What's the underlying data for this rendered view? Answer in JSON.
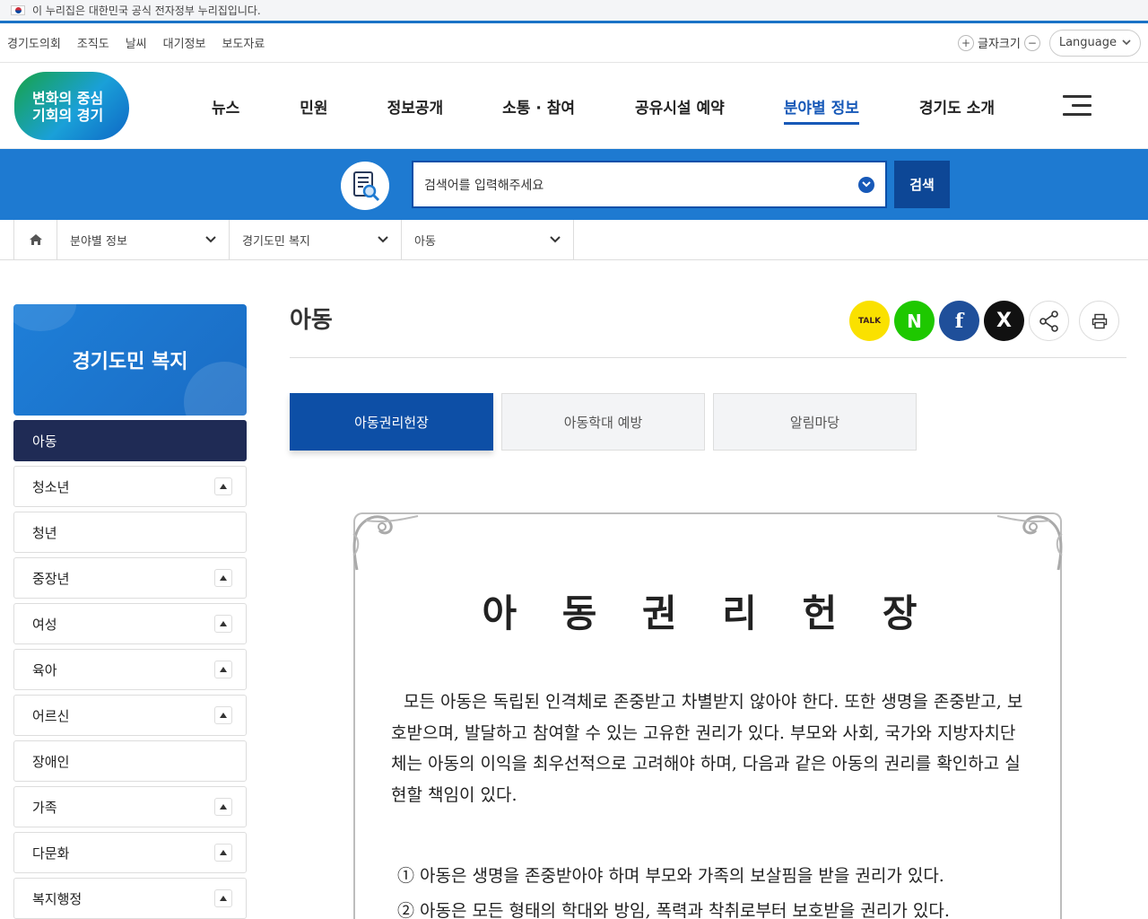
{
  "gov_banner": {
    "text": "이 누리집은 대한민국 공식 전자정부 누리집입니다."
  },
  "util": {
    "links": [
      "경기도의회",
      "조직도",
      "날씨",
      "대기정보",
      "보도자료"
    ],
    "fontsize_label": "글자크기",
    "language_label": "Language"
  },
  "logo": {
    "line1": "변화의 중심",
    "line2": "기회의 경기"
  },
  "nav": [
    "뉴스",
    "민원",
    "정보공개",
    "소통 · 참여",
    "공유시설 예약",
    "분야별 정보",
    "경기도 소개"
  ],
  "nav_active_index": 5,
  "search": {
    "placeholder": "검색어를 입력해주세요",
    "button": "검색"
  },
  "breadcrumb": {
    "level1": "분야별 정보",
    "level2": "경기도민 복지",
    "level3": "아동"
  },
  "sidebar": {
    "title": "경기도민 복지",
    "items": [
      {
        "label": "아동",
        "active": true,
        "toggle": false
      },
      {
        "label": "청소년",
        "toggle": true
      },
      {
        "label": "청년",
        "toggle": false
      },
      {
        "label": "중장년",
        "toggle": true
      },
      {
        "label": "여성",
        "toggle": true
      },
      {
        "label": "육아",
        "toggle": true
      },
      {
        "label": "어르신",
        "toggle": true
      },
      {
        "label": "장애인",
        "toggle": false
      },
      {
        "label": "가족",
        "toggle": true
      },
      {
        "label": "다문화",
        "toggle": true
      },
      {
        "label": "복지행정",
        "toggle": true
      }
    ]
  },
  "page": {
    "title": "아동",
    "share": {
      "talk": "TALK",
      "naver": "N",
      "facebook": "f",
      "x": "X"
    },
    "tabs": [
      "아동권리헌장",
      "아동학대 예방",
      "알림마당"
    ],
    "active_tab": 0
  },
  "charter": {
    "title": "아 동 권 리 헌 장",
    "preamble": "모든 아동은 독립된 인격체로 존중받고 차별받지 않아야 한다. 또한 생명을 존중받고, 보호받으며, 발달하고 참여할 수 있는 고유한 권리가 있다. 부모와 사회, 국가와 지방자치단체는 아동의 이익을 최우선적으로 고려해야 하며, 다음과 같은 아동의 권리를 확인하고 실현할 책임이 있다.",
    "items": [
      "① 아동은 생명을 존중받아야 하며 부모와 가족의 보살핌을 받을 권리가 있다.",
      "② 아동은 모든 형태의 학대와 방임, 폭력과 착취로부터 보호받을 권리가 있다."
    ]
  },
  "colors": {
    "primary": "#1e7ad1",
    "nav_active": "#1759b8",
    "sidebar_active": "#1f2b55",
    "tab_active": "#0d4fa6"
  }
}
